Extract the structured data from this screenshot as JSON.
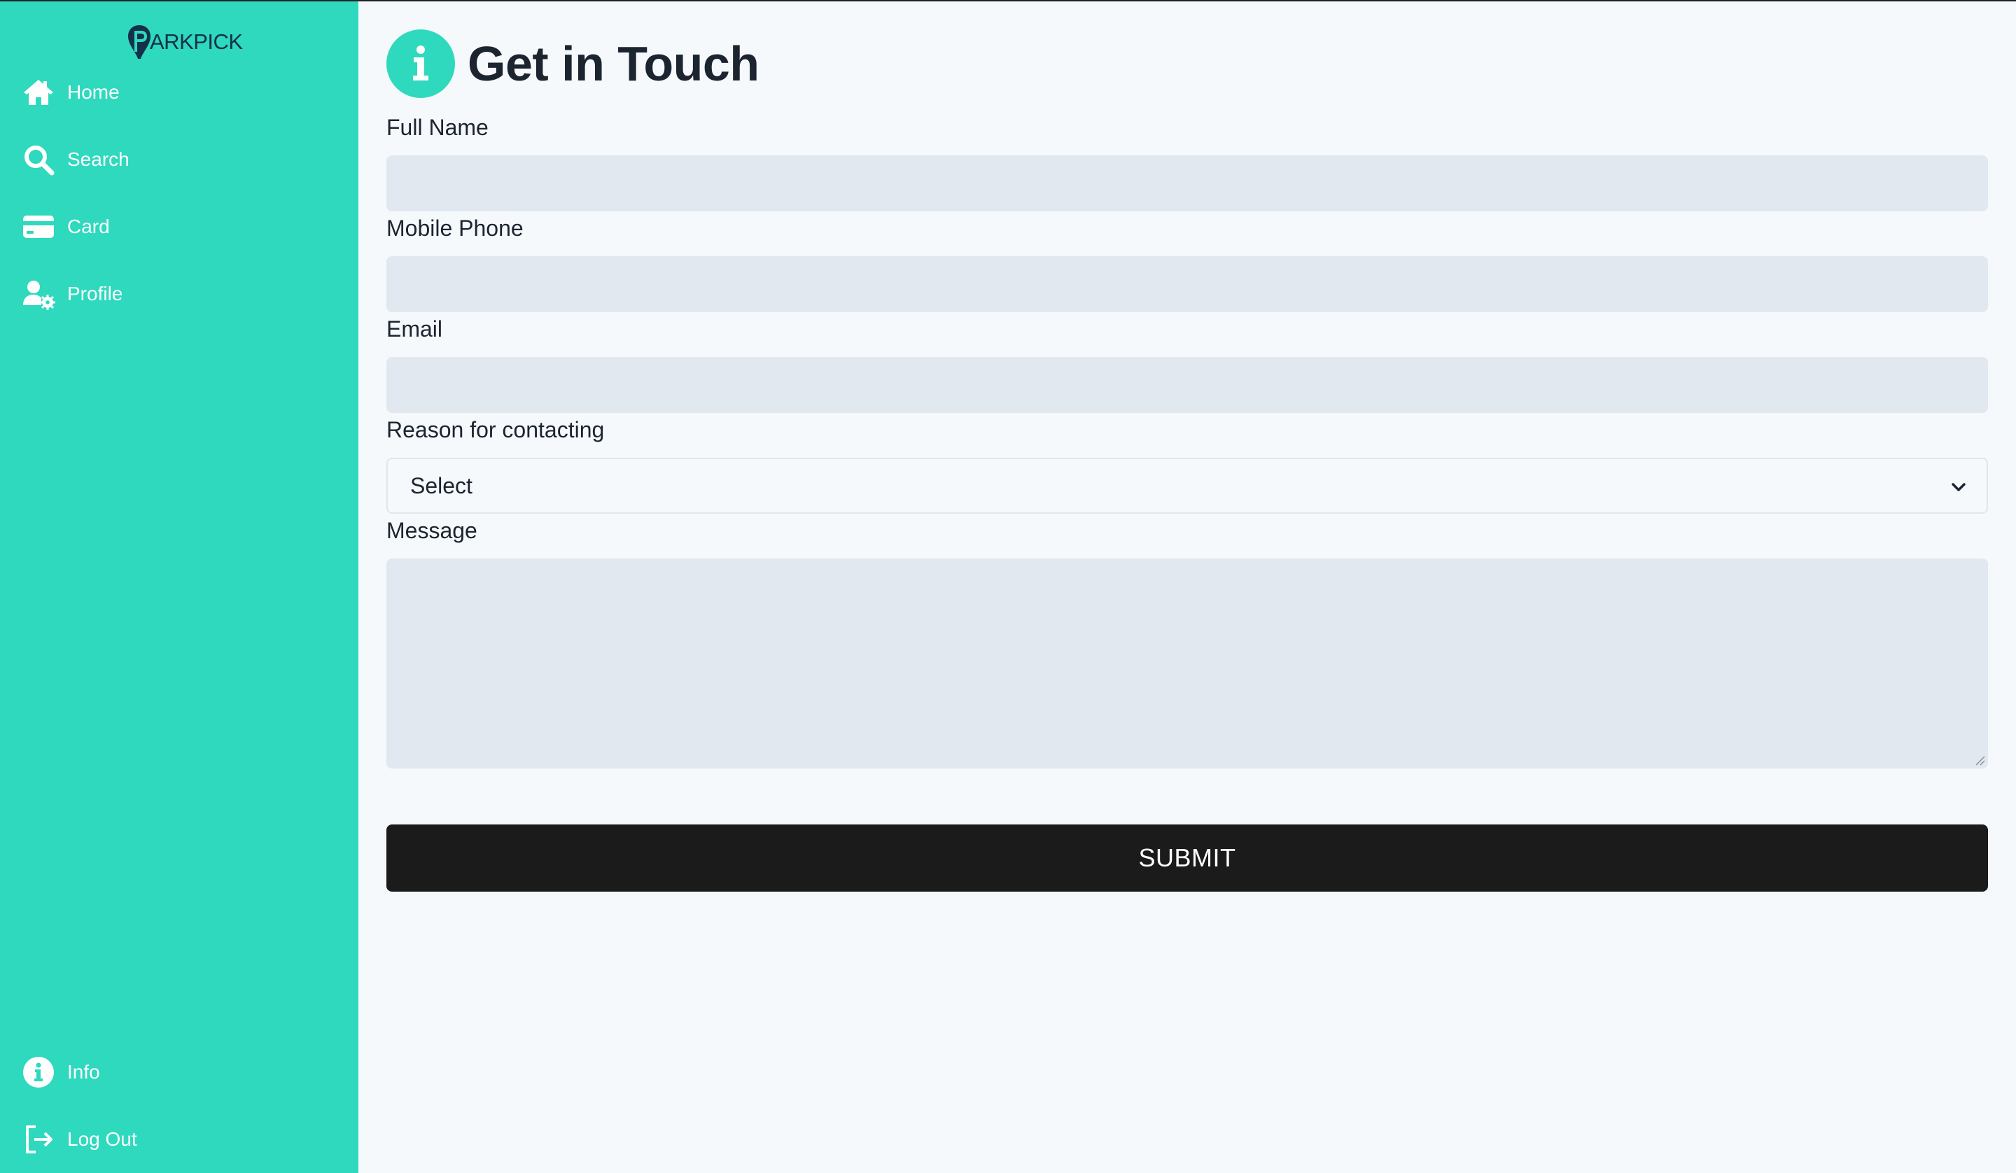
{
  "brand": {
    "logo_text": "ARKPICK",
    "accent_color": "#2ed9be"
  },
  "sidebar": {
    "items": [
      {
        "label": "Home",
        "icon": "home-icon"
      },
      {
        "label": "Search",
        "icon": "search-icon"
      },
      {
        "label": "Card",
        "icon": "credit-card-icon"
      },
      {
        "label": "Profile",
        "icon": "user-settings-icon"
      }
    ],
    "bottom_items": [
      {
        "label": "Info",
        "icon": "info-icon"
      },
      {
        "label": "Log Out",
        "icon": "logout-icon"
      }
    ]
  },
  "page": {
    "title": "Get in Touch",
    "title_icon": "info-icon"
  },
  "form": {
    "full_name": {
      "label": "Full Name",
      "value": ""
    },
    "mobile_phone": {
      "label": "Mobile Phone",
      "value": ""
    },
    "email": {
      "label": "Email",
      "value": ""
    },
    "reason": {
      "label": "Reason for contacting",
      "selected": "Select"
    },
    "message": {
      "label": "Message",
      "value": ""
    },
    "submit_label": "SUBMIT"
  }
}
